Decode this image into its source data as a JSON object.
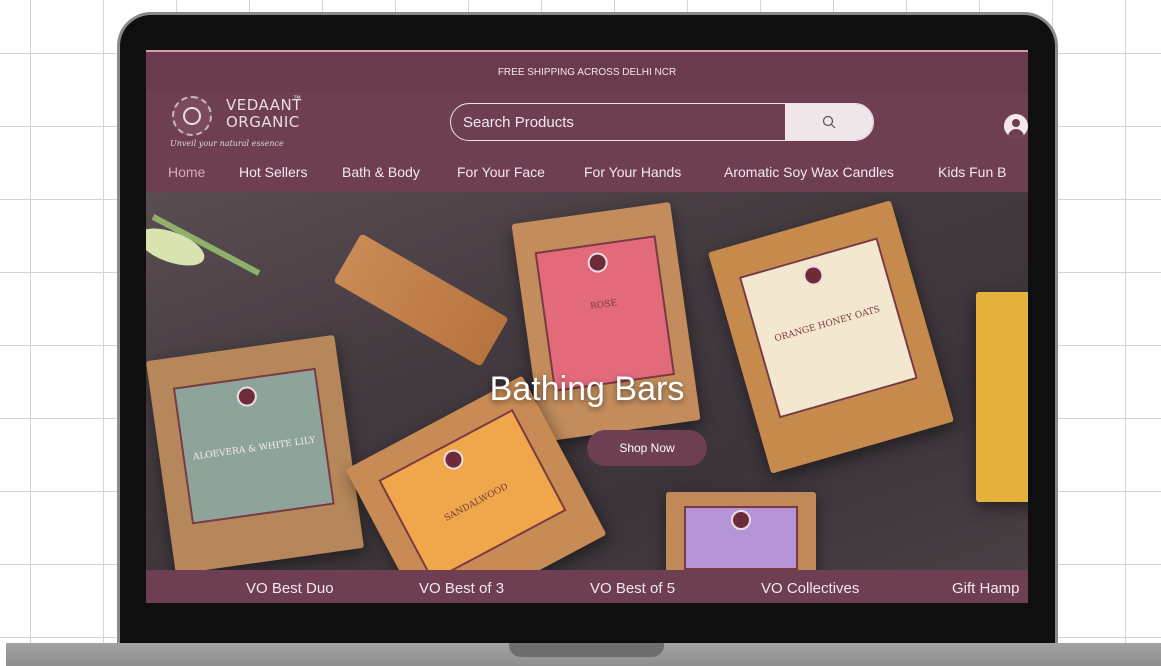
{
  "announcement": "FREE SHIPPING ACROSS DELHI NCR",
  "brand": {
    "line1": "VEDAANT",
    "line2": "ORGANIC",
    "trademark": "™",
    "tagline": "Unveil your natural essence"
  },
  "search": {
    "placeholder": "Search Products",
    "icon": "search-icon"
  },
  "header": {
    "account_icon": "user-circle-icon"
  },
  "nav": [
    {
      "label": "Home",
      "active": true
    },
    {
      "label": "Hot Sellers"
    },
    {
      "label": "Bath & Body"
    },
    {
      "label": "For Your Face"
    },
    {
      "label": "For Your Hands"
    },
    {
      "label": "Aromatic Soy Wax Candles"
    },
    {
      "label": "Kids Fun B"
    }
  ],
  "hero": {
    "title": "Bathing Bars",
    "cta": "Shop Now",
    "boxes": [
      {
        "text": "ALOEVERA & WHITE LILY"
      },
      {
        "text": "ROSE"
      },
      {
        "text": "ORANGE HONEY OATS"
      },
      {
        "text": "SANDALWOOD"
      }
    ]
  },
  "bottom_tabs": [
    "VO Best Duo",
    "VO Best of 3",
    "VO Best of 5",
    "VO Collectives",
    "Gift Hamp"
  ],
  "colors": {
    "brand": "#6e3e53",
    "accent": "#d5aeb9",
    "text_light": "#f3e9ed"
  }
}
